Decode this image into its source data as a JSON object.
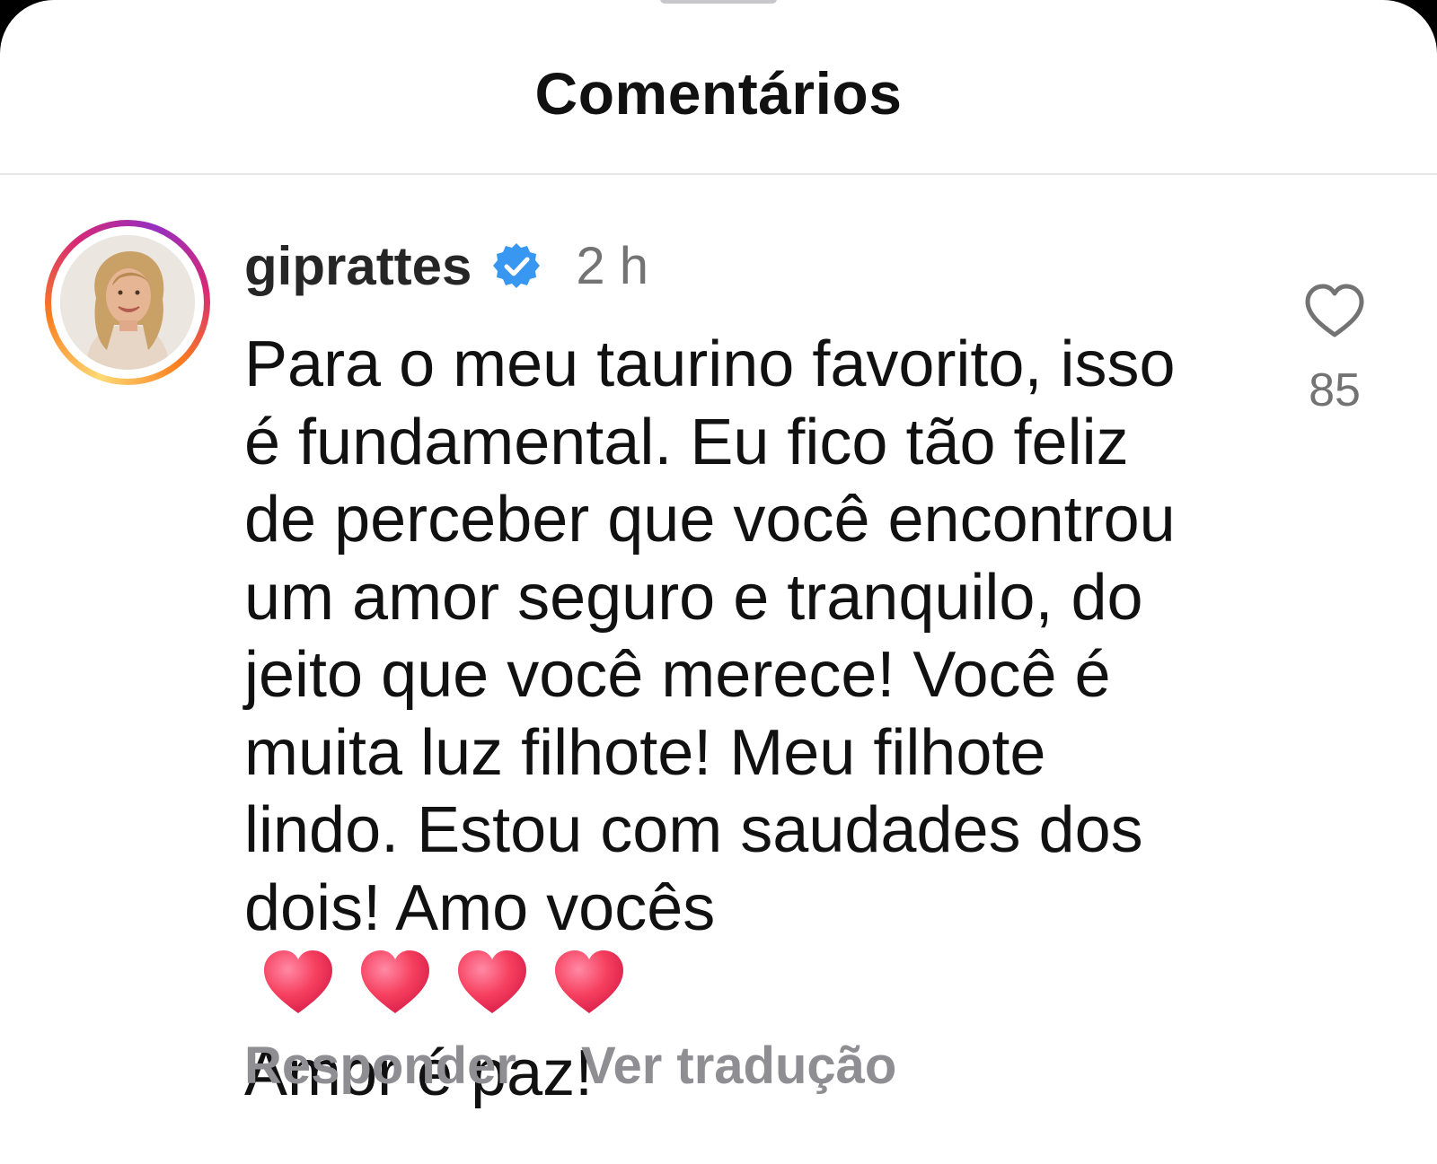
{
  "sheet": {
    "title": "Comentários"
  },
  "comment": {
    "username": "giprattes",
    "verified": true,
    "time": "2 h",
    "text_lines": [
      "Para o meu taurino favorito, isso",
      "é fundamental. Eu fico tão feliz",
      "de perceber que você encontrou",
      "um amor seguro e tranquilo, do",
      "jeito que você merece! Você é",
      "muita luz filhote! Meu filhote",
      "lindo. Estou com saudades dos",
      "dois! Amo vocês",
      "Amor é paz!"
    ],
    "emoji": [
      "heart-emoji",
      "heart-emoji",
      "heart-emoji",
      "heart-emoji"
    ],
    "like_count": "85",
    "reply_label": "Responder",
    "translate_label": "Ver tradução"
  },
  "colors": {
    "verified_badge": "#3897f0",
    "heart_emoji": "#f0325a",
    "muted_text": "#8e8e93",
    "primary_text": "#111111"
  },
  "icons": {
    "like": "heart-outline-icon",
    "verified": "verified-badge-icon"
  }
}
